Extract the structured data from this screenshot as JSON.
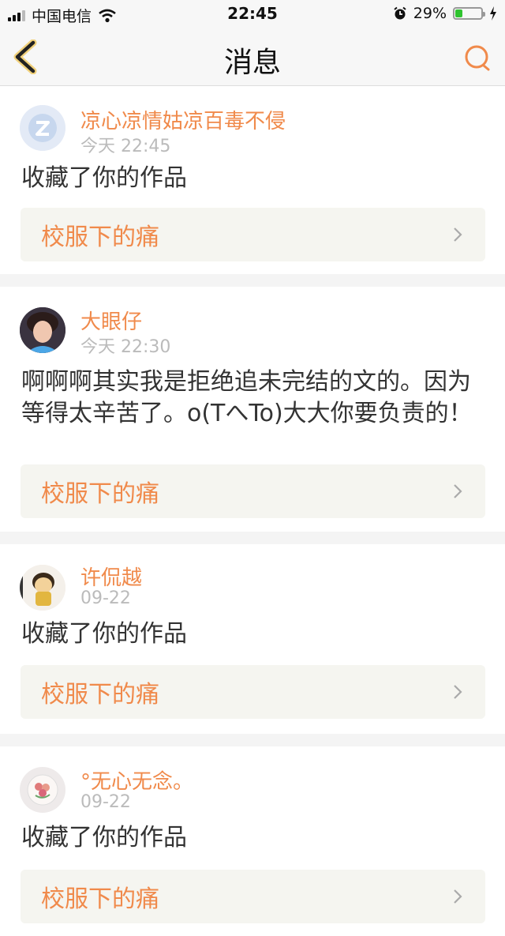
{
  "status_bar": {
    "carrier": "中国电信",
    "time": "22:45",
    "battery_percent": "29%",
    "battery_level": 0.29
  },
  "nav": {
    "title": "消息"
  },
  "colors": {
    "accent": "#f08a4b",
    "card_bg": "#f5f5f0",
    "time_gray": "#bbbbbb"
  },
  "messages": [
    {
      "user": "凉心凉情姑凉百毒不侵",
      "time": "今天 22:45",
      "text": "收藏了你的作品",
      "work": "校服下的痛",
      "avatar_icon": "default-avatar-icon"
    },
    {
      "user": "大眼仔",
      "time": "今天 22:30",
      "text": "啊啊啊其实我是拒绝追未完结的文的。因为等得太辛苦了。o(TへTo)大大你要负责的！",
      "work": "校服下的痛",
      "avatar_icon": "user-photo-avatar"
    },
    {
      "user": "许侃越",
      "time": "09-22",
      "text": "收藏了你的作品",
      "work": "校服下的痛",
      "avatar_icon": "cartoon-avatar"
    },
    {
      "user": "°无心无念。",
      "time": "09-22",
      "text": "收藏了你的作品",
      "work": "校服下的痛",
      "avatar_icon": "flower-avatar"
    }
  ]
}
